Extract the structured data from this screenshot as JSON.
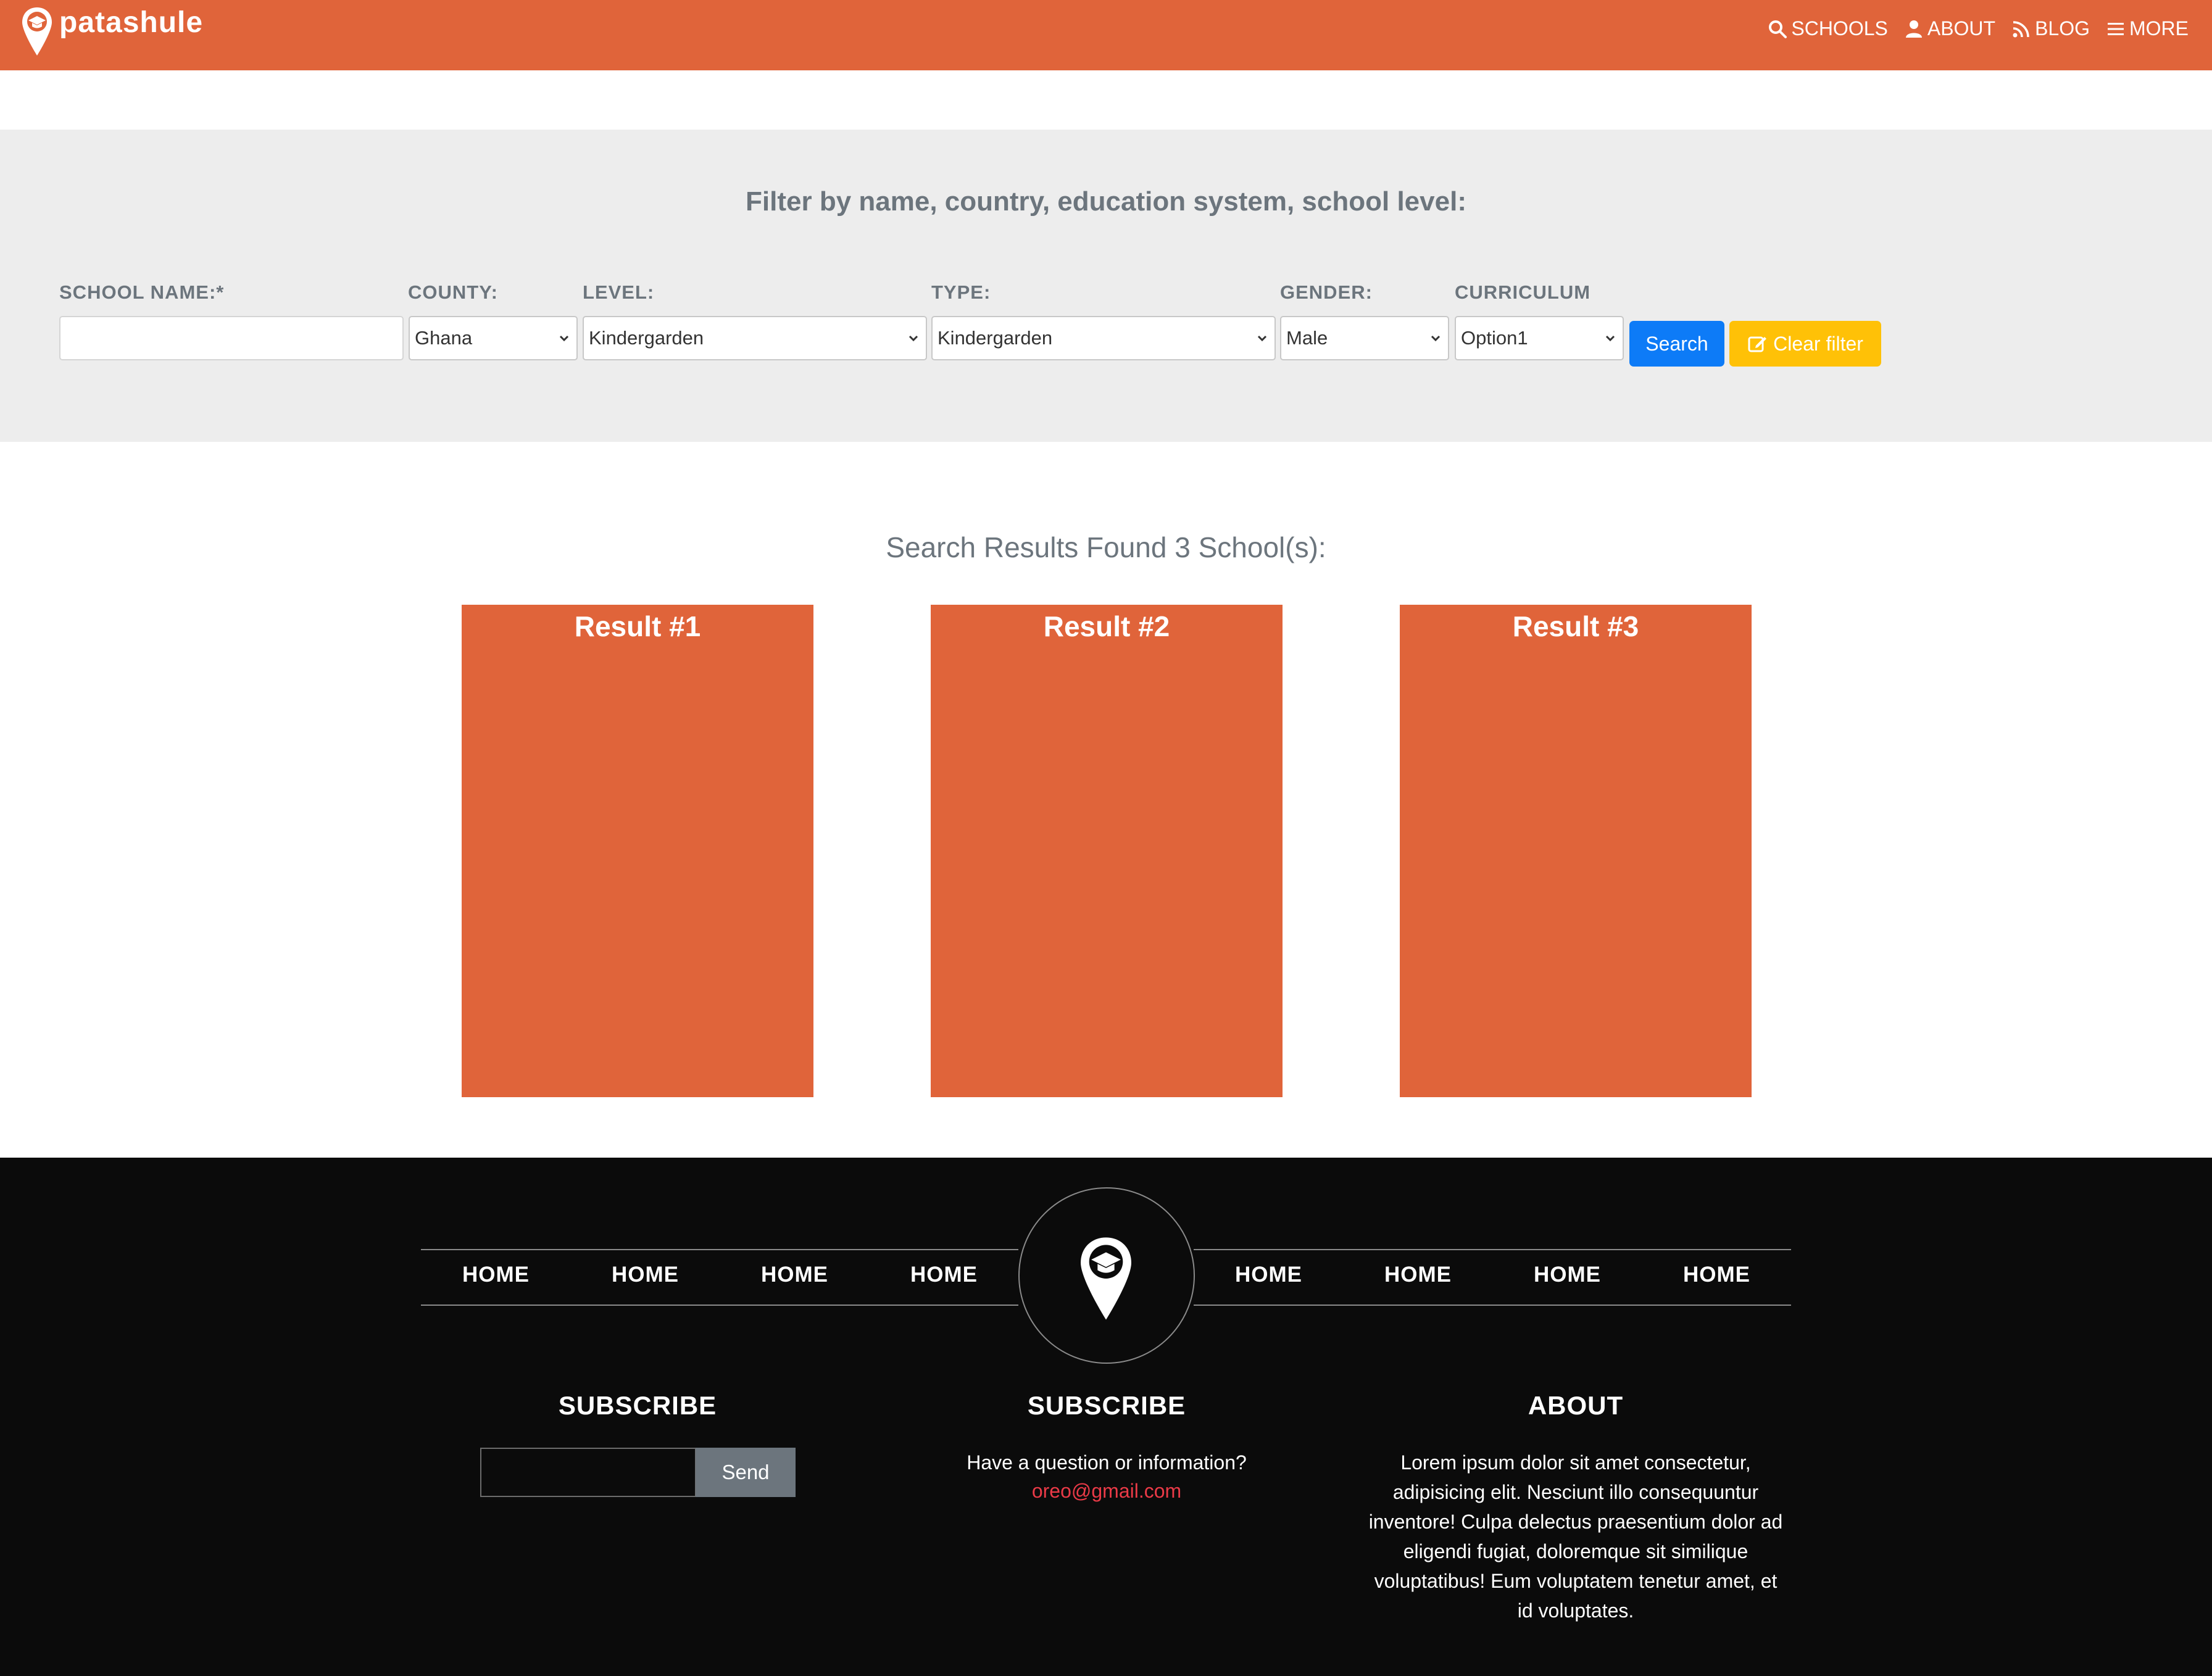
{
  "brand": {
    "name": "patashule"
  },
  "nav": {
    "items": [
      {
        "label": "SCHOOLS",
        "icon": "search-icon"
      },
      {
        "label": "ABOUT",
        "icon": "user-icon"
      },
      {
        "label": "BLOG",
        "icon": "rss-icon"
      },
      {
        "label": "MORE",
        "icon": "menu-icon"
      }
    ]
  },
  "filter": {
    "title": "Filter by name, country, education system, school level:",
    "labels": {
      "school_name": "SCHOOL NAME:*",
      "county": "COUNTY:",
      "level": "LEVEL:",
      "type": "TYPE:",
      "gender": "GENDER:",
      "curriculum": "CURRICULUM"
    },
    "values": {
      "school_name": "",
      "county": "Ghana",
      "level": "Kindergarden",
      "type": "Kindergarden",
      "gender": "Male",
      "curriculum": "Option1"
    },
    "search_label": "Search",
    "clear_label": "Clear filter"
  },
  "results": {
    "title": "Search Results Found 3 School(s):",
    "cards": [
      {
        "title": "Result #1"
      },
      {
        "title": "Result #2"
      },
      {
        "title": "Result #3"
      }
    ]
  },
  "footer": {
    "nav_left": [
      "HOME",
      "HOME",
      "HOME",
      "HOME"
    ],
    "nav_right": [
      "HOME",
      "HOME",
      "HOME",
      "HOME"
    ],
    "col1": {
      "title": "SUBSCRIBE",
      "send_label": "Send",
      "input_value": ""
    },
    "col2": {
      "title": "SUBSCRIBE",
      "question": "Have a question or information?",
      "email": "oreo@gmail.com"
    },
    "col3": {
      "title": "ABOUT",
      "lines": [
        "Lorem ipsum dolor sit amet consectetur,",
        "adipisicing elit. Nesciunt illo consequuntur",
        "inventore! Culpa delectus praesentium dolor ad",
        "eligendi fugiat, doloremque sit similique",
        "voluptatibus! Eum voluptatem tenetur amet, et",
        "id voluptates."
      ]
    }
  },
  "colors": {
    "brand_orange": "#e0643a",
    "search_blue": "#0d7bf7",
    "clear_yellow": "#ffc107",
    "footer_bg": "#0b0b0b",
    "email_red": "#ea3a47"
  }
}
